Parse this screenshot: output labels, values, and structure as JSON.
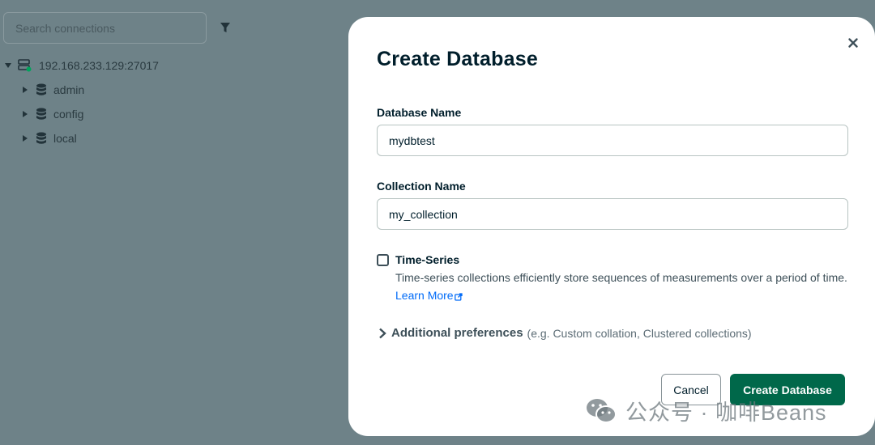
{
  "sidebar": {
    "search_placeholder": "Search connections",
    "connection": {
      "label": "192.168.233.129:27017",
      "status_color": "#00a35c"
    },
    "databases": [
      {
        "label": "admin"
      },
      {
        "label": "config"
      },
      {
        "label": "local"
      }
    ]
  },
  "modal": {
    "title": "Create Database",
    "database_name": {
      "label": "Database Name",
      "value": "mydbtest"
    },
    "collection_name": {
      "label": "Collection Name",
      "value": "my_collection"
    },
    "time_series": {
      "label": "Time-Series",
      "checked": false,
      "description": "Time-series collections efficiently store sequences of measurements over a period of time.",
      "learn_more": "Learn More"
    },
    "additional_prefs": {
      "label": "Additional preferences",
      "hint": "(e.g. Custom collation, Clustered collections)"
    },
    "cancel_label": "Cancel",
    "create_label": "Create Database"
  },
  "watermark": {
    "text": "公众号 · 咖啡Beans"
  },
  "colors": {
    "primary": "#00684a",
    "link": "#016bf8",
    "overlay": "#6e8288"
  }
}
